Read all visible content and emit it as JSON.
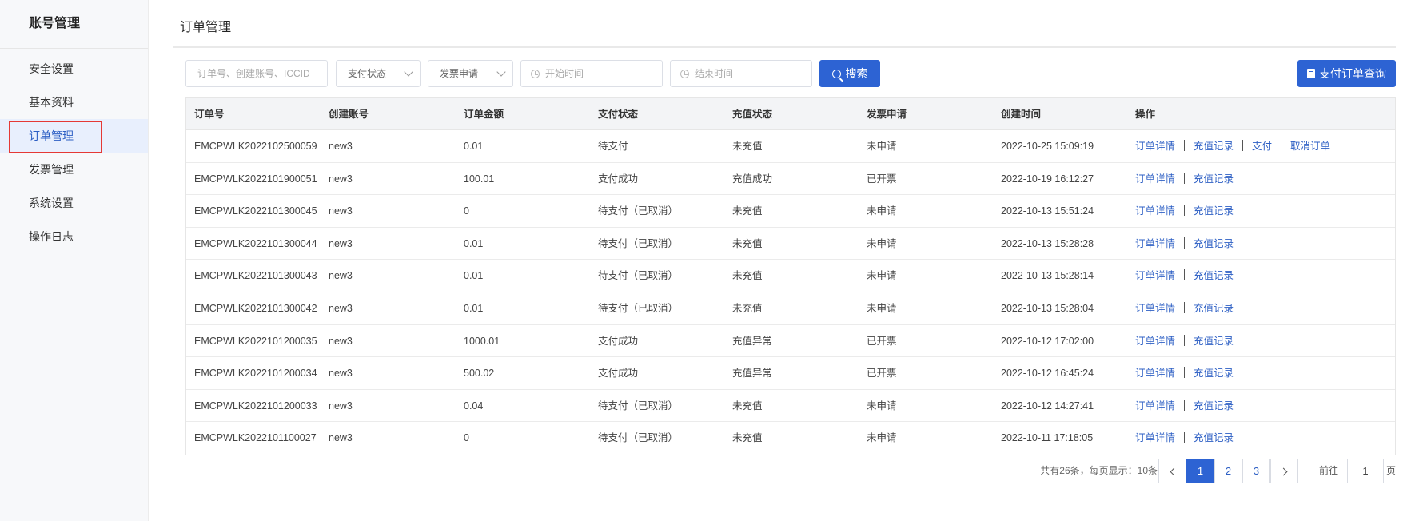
{
  "sidebar": {
    "title": "账号管理",
    "items": [
      {
        "label": "安全设置"
      },
      {
        "label": "基本资料"
      },
      {
        "label": "订单管理"
      },
      {
        "label": "发票管理"
      },
      {
        "label": "系统设置"
      },
      {
        "label": "操作日志"
      }
    ]
  },
  "page_title": "订单管理",
  "filters": {
    "search_placeholder": "订单号、创建账号、ICCID",
    "pay_status": "支付状态",
    "invoice": "发票申请",
    "start_placeholder": "开始时间",
    "end_placeholder": "结束时间",
    "search_button": "搜索",
    "query_button": "支付订单查询"
  },
  "table": {
    "headers": [
      "订单号",
      "创建账号",
      "订单金额",
      "支付状态",
      "充值状态",
      "发票申请",
      "创建时间",
      "操作"
    ],
    "rows": [
      {
        "order": "EMCPWLK2022102500059",
        "account": "new3",
        "amount": "0.01",
        "pay": "待支付",
        "recharge": "未充值",
        "invoice": "未申请",
        "time": "2022-10-25 15:09:19",
        "ops": [
          "订单详情",
          "充值记录",
          "支付",
          "取消订单"
        ]
      },
      {
        "order": "EMCPWLK2022101900051",
        "account": "new3",
        "amount": "100.01",
        "pay": "支付成功",
        "recharge": "充值成功",
        "invoice": "已开票",
        "time": "2022-10-19 16:12:27",
        "ops": [
          "订单详情",
          "充值记录"
        ]
      },
      {
        "order": "EMCPWLK2022101300045",
        "account": "new3",
        "amount": "0",
        "pay": "待支付（已取消）",
        "recharge": "未充值",
        "invoice": "未申请",
        "time": "2022-10-13 15:51:24",
        "ops": [
          "订单详情",
          "充值记录"
        ]
      },
      {
        "order": "EMCPWLK2022101300044",
        "account": "new3",
        "amount": "0.01",
        "pay": "待支付（已取消）",
        "recharge": "未充值",
        "invoice": "未申请",
        "time": "2022-10-13 15:28:28",
        "ops": [
          "订单详情",
          "充值记录"
        ]
      },
      {
        "order": "EMCPWLK2022101300043",
        "account": "new3",
        "amount": "0.01",
        "pay": "待支付（已取消）",
        "recharge": "未充值",
        "invoice": "未申请",
        "time": "2022-10-13 15:28:14",
        "ops": [
          "订单详情",
          "充值记录"
        ]
      },
      {
        "order": "EMCPWLK2022101300042",
        "account": "new3",
        "amount": "0.01",
        "pay": "待支付（已取消）",
        "recharge": "未充值",
        "invoice": "未申请",
        "time": "2022-10-13 15:28:04",
        "ops": [
          "订单详情",
          "充值记录"
        ]
      },
      {
        "order": "EMCPWLK2022101200035",
        "account": "new3",
        "amount": "1000.01",
        "pay": "支付成功",
        "recharge": "充值异常",
        "invoice": "已开票",
        "time": "2022-10-12 17:02:00",
        "ops": [
          "订单详情",
          "充值记录"
        ]
      },
      {
        "order": "EMCPWLK2022101200034",
        "account": "new3",
        "amount": "500.02",
        "pay": "支付成功",
        "recharge": "充值异常",
        "invoice": "已开票",
        "time": "2022-10-12 16:45:24",
        "ops": [
          "订单详情",
          "充值记录"
        ]
      },
      {
        "order": "EMCPWLK2022101200033",
        "account": "new3",
        "amount": "0.04",
        "pay": "待支付（已取消）",
        "recharge": "未充值",
        "invoice": "未申请",
        "time": "2022-10-12 14:27:41",
        "ops": [
          "订单详情",
          "充值记录"
        ]
      },
      {
        "order": "EMCPWLK2022101100027",
        "account": "new3",
        "amount": "0",
        "pay": "待支付（已取消）",
        "recharge": "未充值",
        "invoice": "未申请",
        "time": "2022-10-11 17:18:05",
        "ops": [
          "订单详情",
          "充值记录"
        ]
      }
    ]
  },
  "pagination": {
    "total_text": "共有26条，每页显示：10条",
    "pages": [
      "1",
      "2",
      "3"
    ],
    "current": "1",
    "goto_label": "前往",
    "goto_value": "1",
    "page_suffix": "页"
  },
  "colors": {
    "accent": "#2d63d3",
    "link": "#2d5fc4",
    "highlight_border": "#e53935"
  }
}
